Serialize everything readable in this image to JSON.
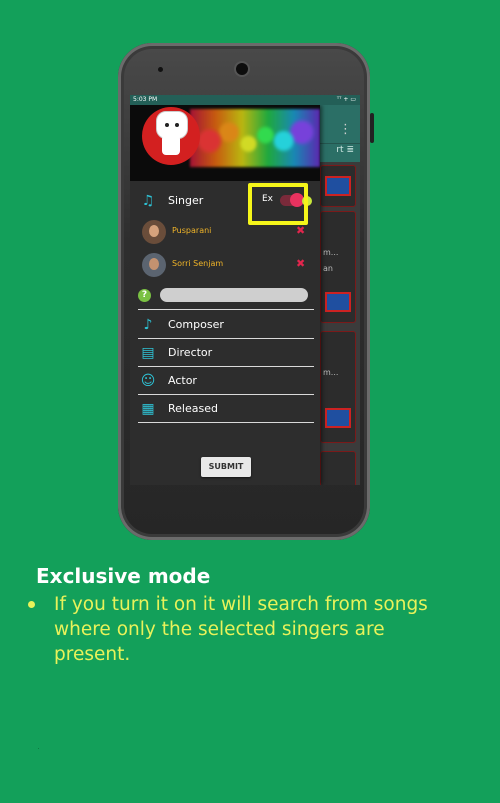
{
  "status_bar": {
    "time": "5:03 PM",
    "icons": "ᵀᵀ + ▭"
  },
  "app_background": {
    "sort_label": "rt ≣",
    "overflow_menu": "⋮",
    "card_texts": [
      "m...",
      "an",
      "m...",
      "m..."
    ]
  },
  "drawer": {
    "singer_label": "Singer",
    "exclusive_label": "Ex",
    "exclusive_toggle_on": true,
    "selected_singers": [
      "Pusparani",
      "Sorri Senjam"
    ],
    "remove_icon": "✖",
    "help_icon": "?",
    "search_placeholder": "",
    "menu_items": [
      {
        "label": "Composer",
        "icon": "music-note-icon",
        "glyph": "♪"
      },
      {
        "label": "Director",
        "icon": "clapper-icon",
        "glyph": "▤"
      },
      {
        "label": "Actor",
        "icon": "masks-icon",
        "glyph": "☺"
      },
      {
        "label": "Released",
        "icon": "calendar-icon",
        "glyph": "▦"
      }
    ],
    "submit_label": "SUBMIT"
  },
  "colors": {
    "accent": "#2ec3d6",
    "toggle": "#e8325f",
    "highlight": "#f5f51a",
    "singer_name": "#f0b428",
    "caption": "#e8f25a"
  },
  "caption": {
    "title": "Exclusive mode",
    "bullet": "If you turn it on it will search from songs where only the selected singers are present."
  }
}
